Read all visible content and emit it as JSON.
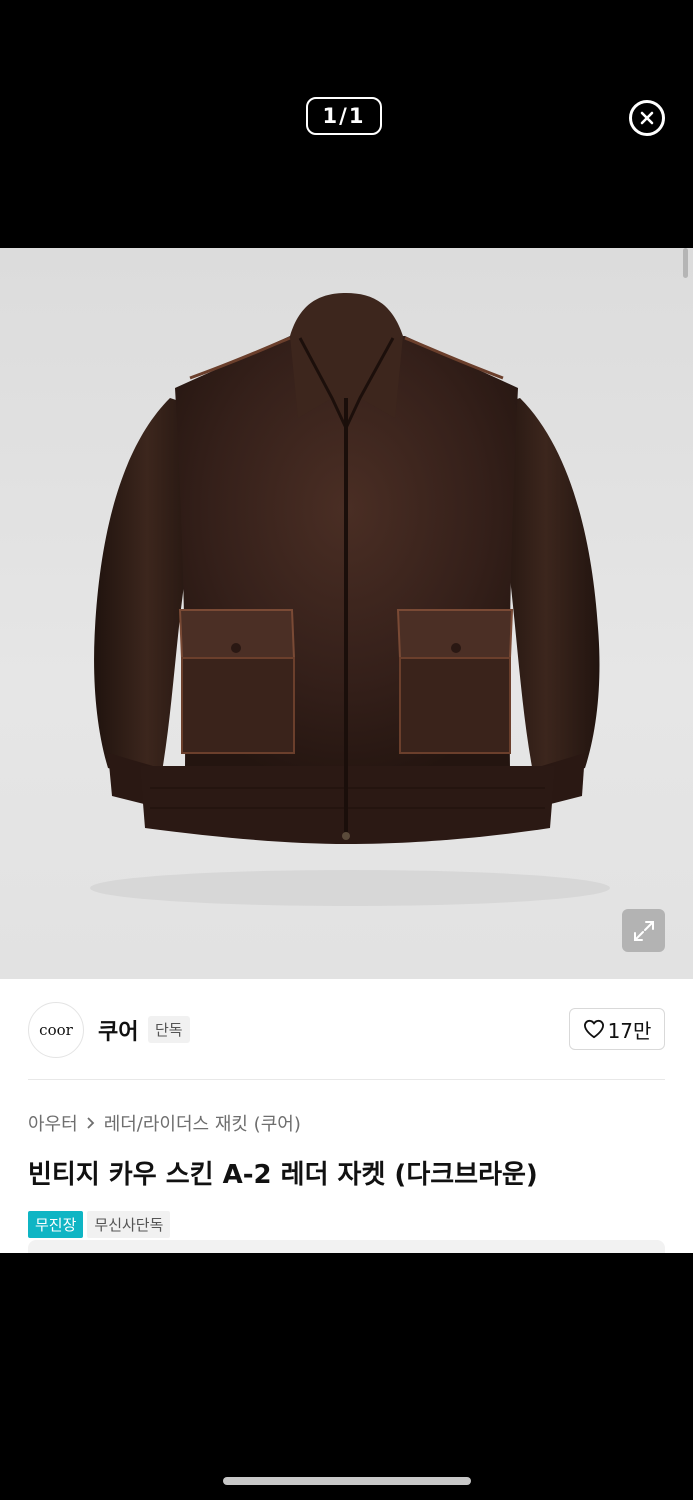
{
  "viewer": {
    "counter": "1/1",
    "close_icon": "close-circle-icon",
    "expand_icon": "expand-icon"
  },
  "product_image": {
    "subject": "dark brown leather A-2 jacket",
    "colors": {
      "background": "#e0e0e0",
      "leather": "#3a231b"
    }
  },
  "brand": {
    "logo_text": "coor",
    "name": "쿠어",
    "tag": "단독"
  },
  "likes": {
    "icon": "heart-icon",
    "count": "17만"
  },
  "breadcrumb": {
    "items": [
      "아우터",
      "레더/라이더스 재킷 (쿠어)"
    ],
    "separator_icon": "chevron-right-icon"
  },
  "product": {
    "title": "빈티지 카우 스킨 A-2 레더 자켓 (다크브라운)",
    "badges": [
      {
        "label": "무진장",
        "color": "#0fb5c4"
      },
      {
        "label": "무신사단독"
      }
    ]
  }
}
